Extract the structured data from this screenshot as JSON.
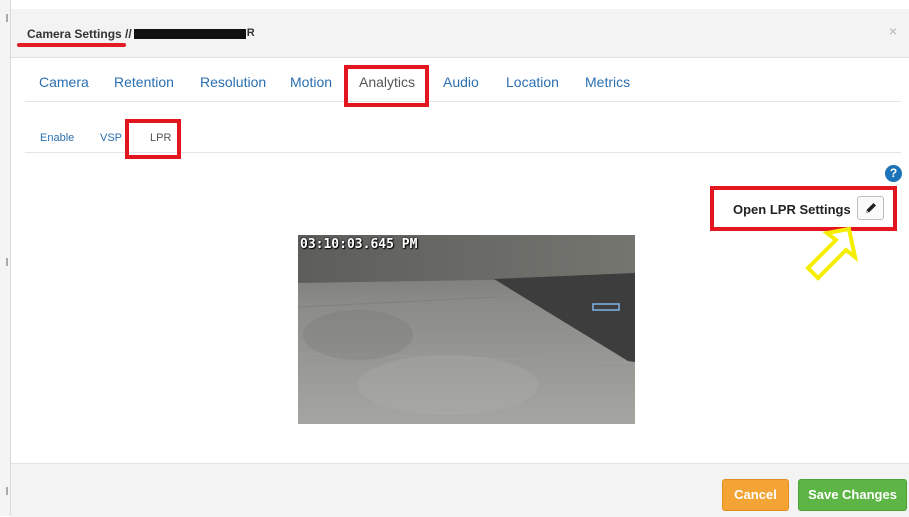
{
  "dialog": {
    "title": "Camera Settings //",
    "close_glyph": "×"
  },
  "tabs": [
    {
      "label": "Camera"
    },
    {
      "label": "Retention"
    },
    {
      "label": "Resolution"
    },
    {
      "label": "Motion"
    },
    {
      "label": "Analytics",
      "active": true
    },
    {
      "label": "Audio"
    },
    {
      "label": "Location"
    },
    {
      "label": "Metrics"
    }
  ],
  "subtabs": [
    {
      "label": "Enable"
    },
    {
      "label": "VSP"
    },
    {
      "label": "LPR",
      "active": true
    }
  ],
  "help": {
    "glyph": "?"
  },
  "lpr": {
    "label": "Open LPR Settings",
    "edit_icon": "pencil-icon"
  },
  "camera": {
    "timestamp": "03:10:03.645 PM"
  },
  "footer": {
    "cancel_label": "Cancel",
    "save_label": "Save Changes"
  },
  "colors": {
    "link": "#2a6fb0",
    "annotation_red": "#e3151f",
    "annotation_yellow": "#f5ee00",
    "cancel_orange": "#f4a335",
    "save_green": "#5cb544",
    "help_blue": "#1d73b9"
  }
}
